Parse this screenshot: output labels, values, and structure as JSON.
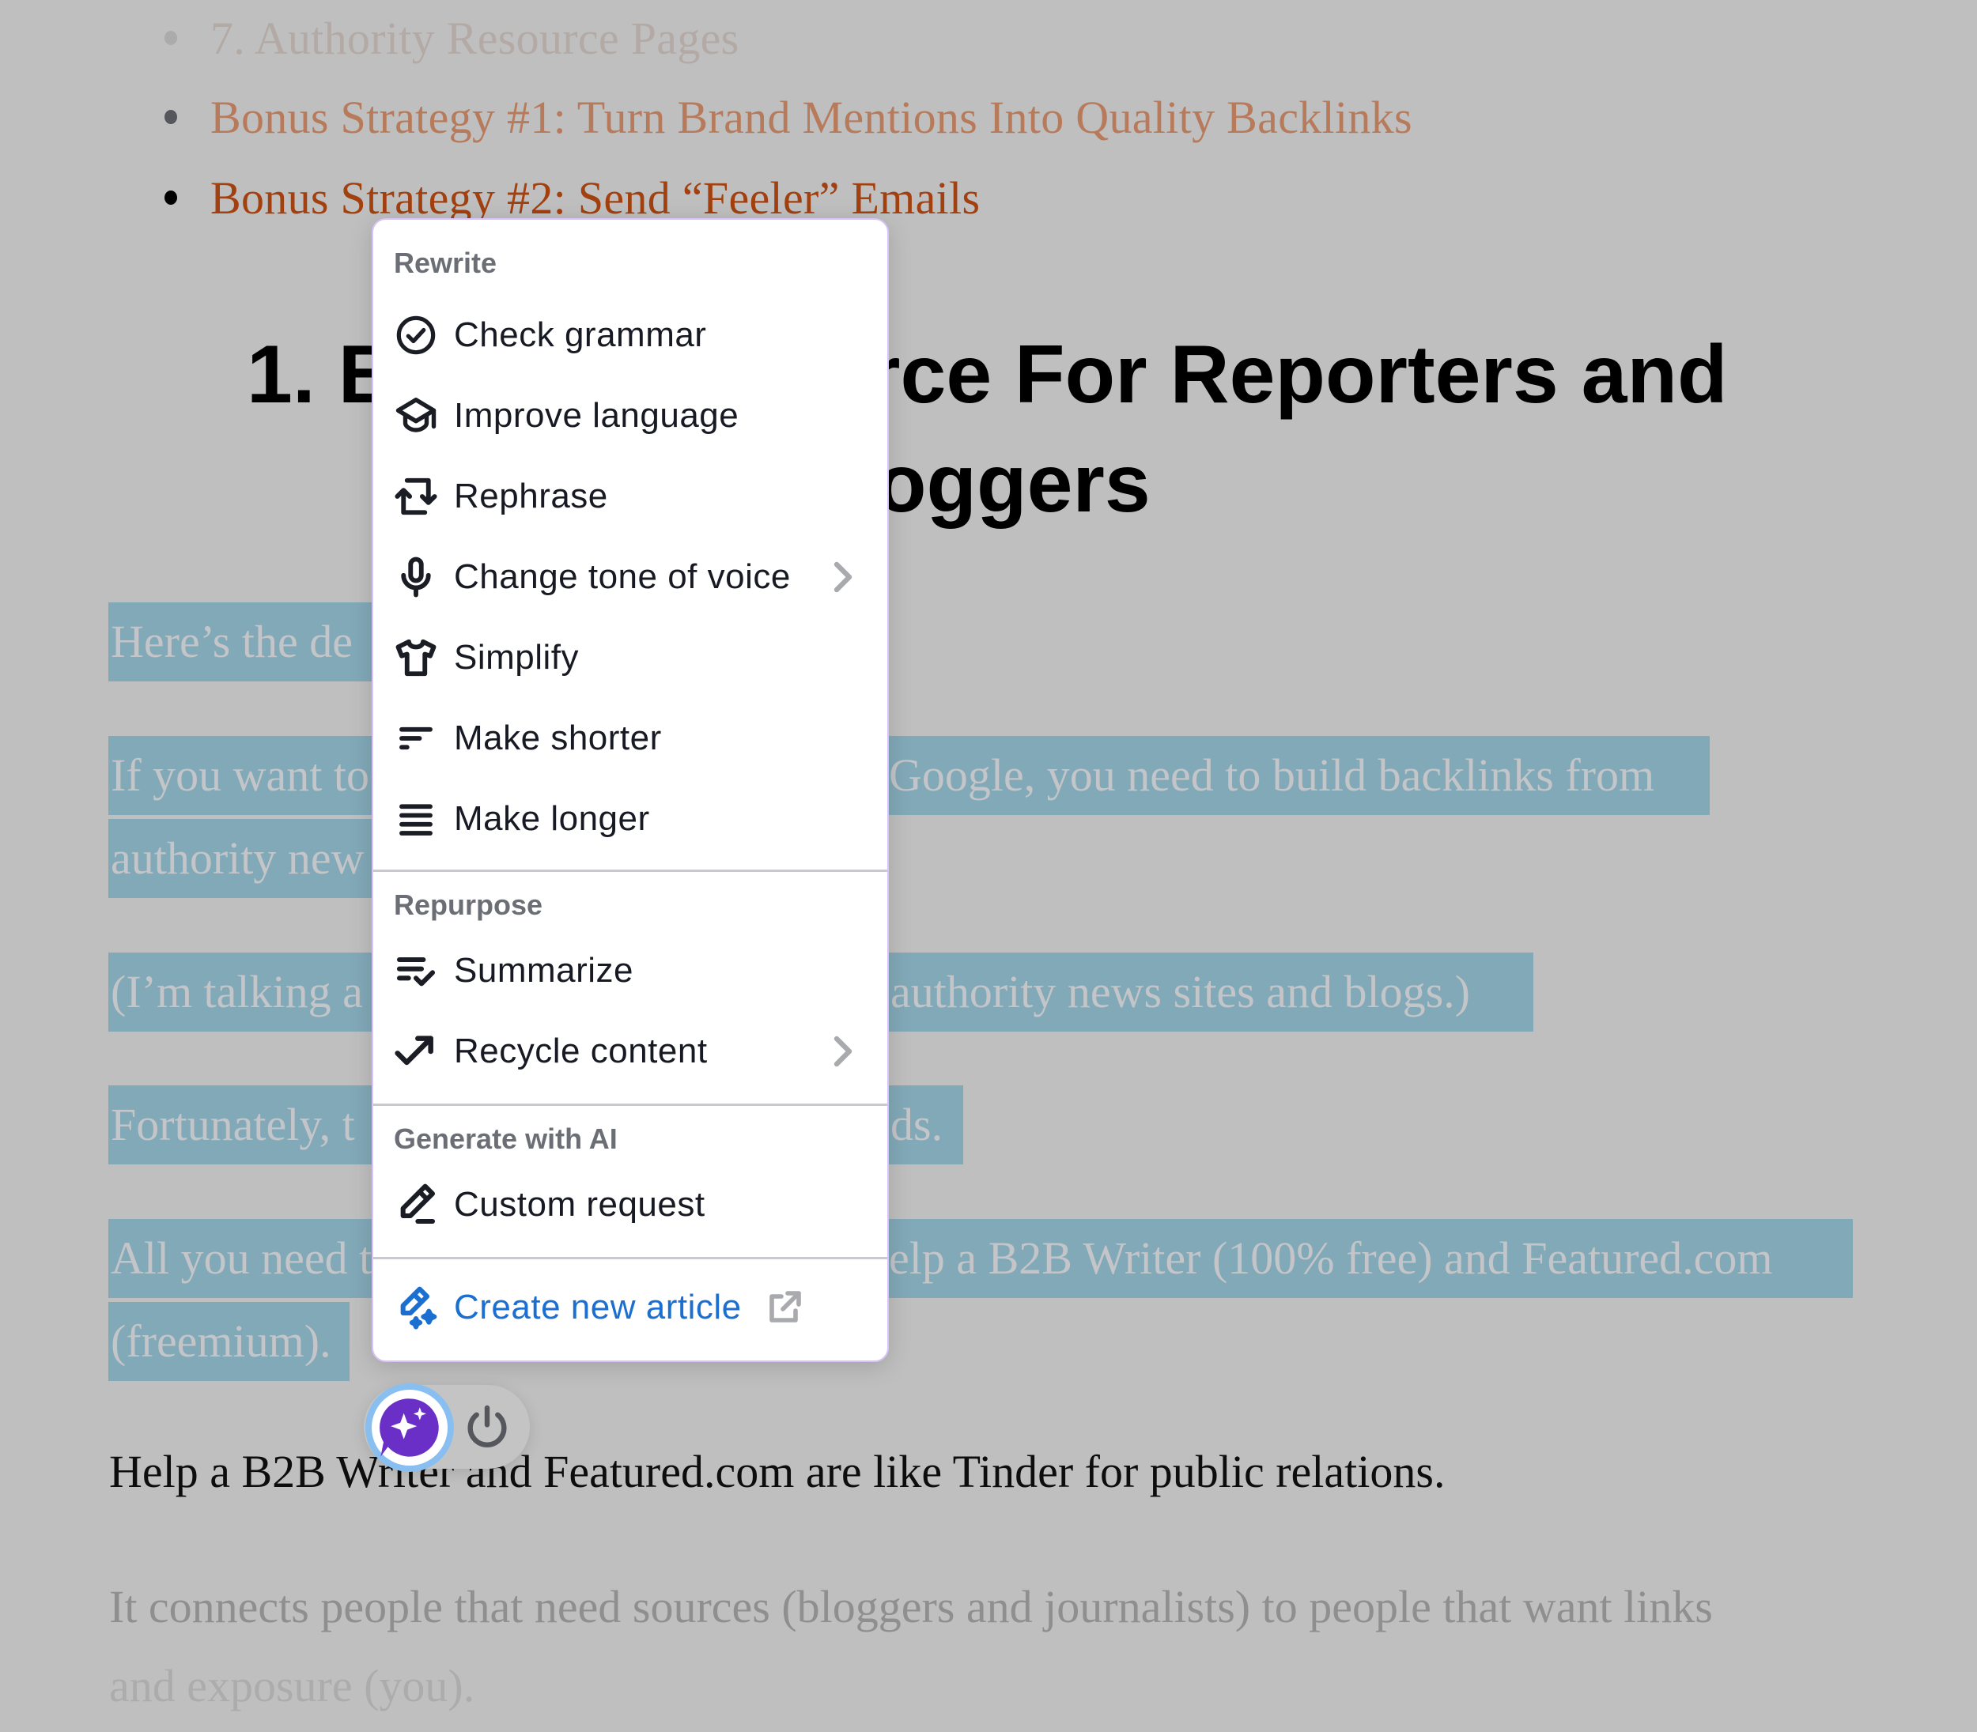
{
  "article": {
    "toc_items": [
      {
        "label": "7. Authority Resource Pages",
        "state": "faded"
      },
      {
        "label": "Bonus Strategy #1: Turn Brand Mentions Into Quality Backlinks",
        "state": "visited"
      },
      {
        "label": "Bonus Strategy #2: Send “Feeler” Emails",
        "state": "link"
      }
    ],
    "heading_line1_left": "1. B",
    "heading_line1_right": "rce For Reporters and",
    "heading_line2_right": "oggers",
    "selected_paragraphs": [
      {
        "left": "Here’s the de",
        "right": ""
      },
      {
        "left": "If you want to",
        "right": "Google, you need to build backlinks from"
      },
      {
        "left": "authority new",
        "right": ""
      },
      {
        "left": "(I’m talking a",
        "right": "authority news sites and blogs.)"
      },
      {
        "left": "Fortunately, t",
        "right": "ds."
      },
      {
        "left": "All you need t",
        "right": "elp a B2B Writer (100% free) and Featured.com"
      },
      {
        "left": "(freemium).",
        "right": ""
      }
    ],
    "paragraph_help": "Help a B2B Writer and Featured.com are like Tinder for public relations.",
    "paragraph_connects_1": "It connects people that need sources (bloggers and journalists) to people that want links",
    "paragraph_connects_2": "and exposure (you)."
  },
  "menu": {
    "sections": [
      {
        "title": "Rewrite",
        "items": [
          {
            "label": "Check grammar",
            "icon": "check-circle-icon",
            "submenu": false
          },
          {
            "label": "Improve language",
            "icon": "graduation-cap-icon",
            "submenu": false
          },
          {
            "label": "Rephrase",
            "icon": "rephrase-arrows-icon",
            "submenu": false
          },
          {
            "label": "Change tone of voice",
            "icon": "microphone-icon",
            "submenu": true
          },
          {
            "label": "Simplify",
            "icon": "tshirt-icon",
            "submenu": false
          },
          {
            "label": "Make shorter",
            "icon": "short-lines-icon",
            "submenu": false
          },
          {
            "label": "Make longer",
            "icon": "long-lines-icon",
            "submenu": false
          }
        ]
      },
      {
        "title": "Repurpose",
        "items": [
          {
            "label": "Summarize",
            "icon": "summarize-icon",
            "submenu": false
          },
          {
            "label": "Recycle content",
            "icon": "trend-arrow-icon",
            "submenu": true
          }
        ]
      },
      {
        "title": "Generate with AI",
        "items": [
          {
            "label": "Custom request",
            "icon": "pencil-icon",
            "submenu": false
          }
        ]
      }
    ],
    "footer_item": {
      "label": "Create new article",
      "icon": "magic-pencil-icon",
      "external": true
    }
  },
  "colors": {
    "accent_blue": "#1a6fd1",
    "ai_purple": "#6a2fc6",
    "selection": "#82a9b8",
    "menu_border": "#d9c2f7"
  },
  "floating": {
    "ai_button": "ai-assistant",
    "power_button": "power"
  }
}
